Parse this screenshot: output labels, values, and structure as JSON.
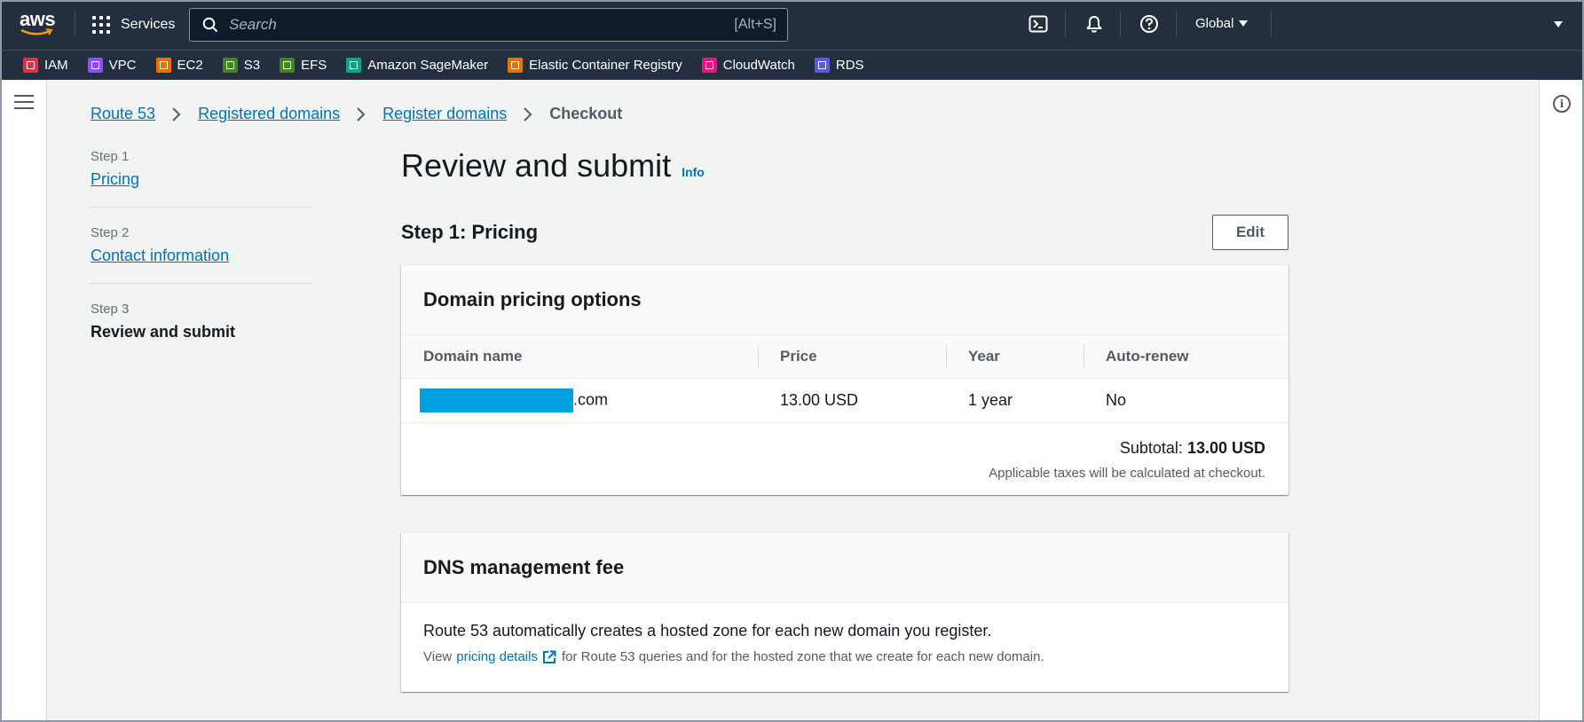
{
  "topnav": {
    "logo_text": "aws",
    "services_label": "Services",
    "search_placeholder": "Search",
    "search_hint": "[Alt+S]",
    "region_label": "Global"
  },
  "favorites": [
    {
      "label": "IAM",
      "color": "#dd344c"
    },
    {
      "label": "VPC",
      "color": "#8c4fff"
    },
    {
      "label": "EC2",
      "color": "#ed7100"
    },
    {
      "label": "S3",
      "color": "#3f8624"
    },
    {
      "label": "EFS",
      "color": "#3f8624"
    },
    {
      "label": "Amazon SageMaker",
      "color": "#01a88d"
    },
    {
      "label": "Elastic Container Registry",
      "color": "#ed7100"
    },
    {
      "label": "CloudWatch",
      "color": "#e7157b"
    },
    {
      "label": "RDS",
      "color": "#5a5ae6"
    }
  ],
  "breadcrumb": {
    "items": [
      "Route 53",
      "Registered domains",
      "Register domains"
    ],
    "current": "Checkout"
  },
  "steps": [
    {
      "num": "Step 1",
      "label": "Pricing"
    },
    {
      "num": "Step 2",
      "label": "Contact information"
    },
    {
      "num": "Step 3",
      "label": "Review and submit"
    }
  ],
  "main": {
    "title": "Review and submit",
    "info_label": "Info",
    "section_title": "Step 1: Pricing",
    "edit_label": "Edit"
  },
  "pricing": {
    "title": "Domain pricing options",
    "columns": [
      "Domain name",
      "Price",
      "Year",
      "Auto-renew"
    ],
    "row": {
      "domain_suffix": ".com",
      "price": "13.00 USD",
      "year": "1 year",
      "auto_renew": "No"
    },
    "subtotal_label": "Subtotal:",
    "subtotal_value": "13.00 USD",
    "tax_note": "Applicable taxes will be calculated at checkout."
  },
  "dns": {
    "title": "DNS management fee",
    "text": "Route 53 automatically creates a hosted zone for each new domain you register.",
    "view_prefix": "View",
    "link_label": "pricing details",
    "view_suffix": "for Route 53 queries and for the hosted zone that we create for each new domain."
  },
  "colors": {
    "nav_bg": "#232f3e",
    "link": "#0073bb",
    "redaction": "#00a1e0"
  }
}
